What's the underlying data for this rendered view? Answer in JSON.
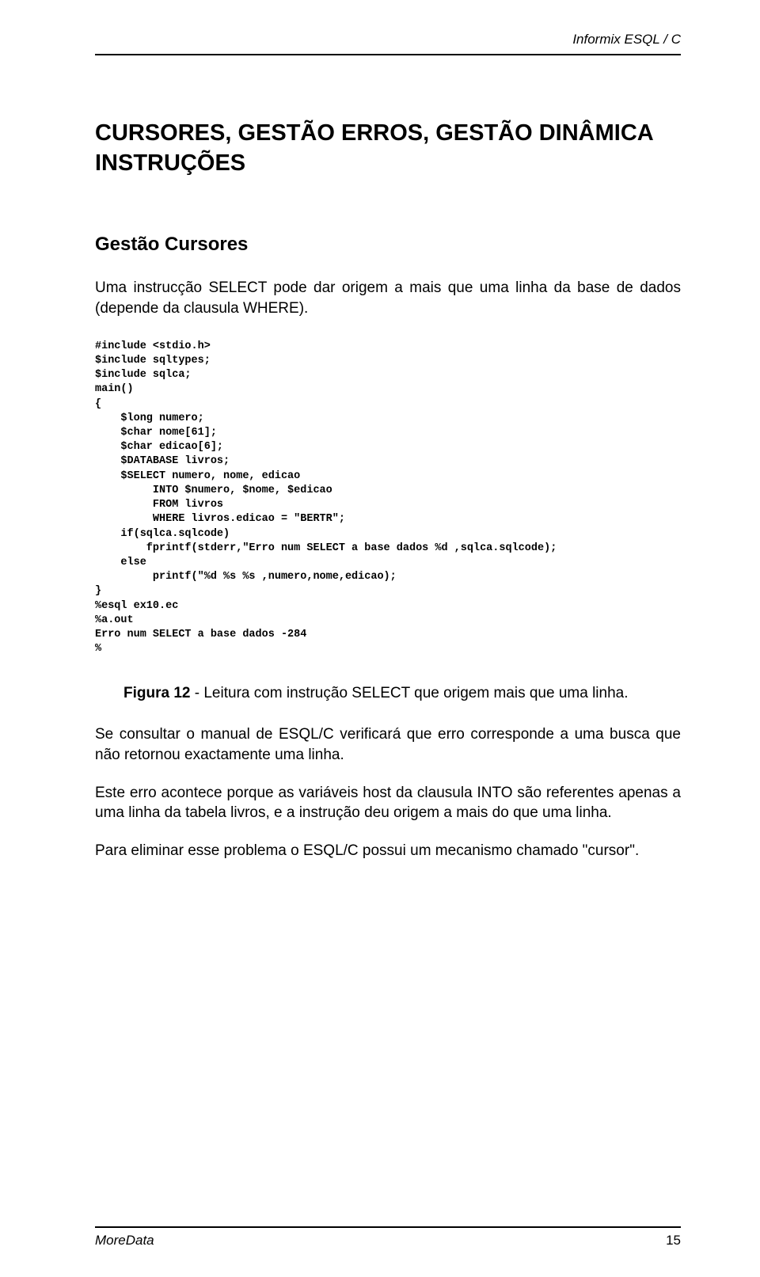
{
  "header": {
    "title": "Informix ESQL / C"
  },
  "h1_line1": "CURSORES, GESTÃO ERROS, GESTÃO DINÂMICA",
  "h1_line2": "INSTRUÇÕES",
  "h2": "Gestão Cursores",
  "para1": "Uma instrucção SELECT pode dar origem a mais que uma linha da base de dados (depende da clausula WHERE).",
  "code": "#include <stdio.h>\n$include sqltypes;\n$include sqlca;\nmain()\n{\n    $long numero;\n    $char nome[61];\n    $char edicao[6];\n    $DATABASE livros;\n    $SELECT numero, nome, edicao\n         INTO $numero, $nome, $edicao\n         FROM livros\n         WHERE livros.edicao = \"BERTR\";\n    if(sqlca.sqlcode)\n        fprintf(stderr,\"Erro num SELECT a base dados %d ,sqlca.sqlcode);\n    else\n         printf(\"%d %s %s ,numero,nome,edicao);\n}\n%esql ex10.ec\n%a.out\nErro num SELECT a base dados -284\n%",
  "figure": {
    "label": "Figura 12",
    "caption": " - Leitura com instrução SELECT que origem mais que uma linha."
  },
  "para2": "Se consultar o manual de ESQL/C verificará que erro corresponde a uma busca que não retornou exactamente uma linha.",
  "para3": "Este erro acontece porque as variáveis host da clausula INTO são referentes apenas a uma linha da tabela livros, e a instrução deu origem a mais do que uma linha.",
  "para4": "Para eliminar esse problema o ESQL/C possui um mecanismo chamado \"cursor\".",
  "footer": {
    "left": "MoreData",
    "right": "15"
  }
}
